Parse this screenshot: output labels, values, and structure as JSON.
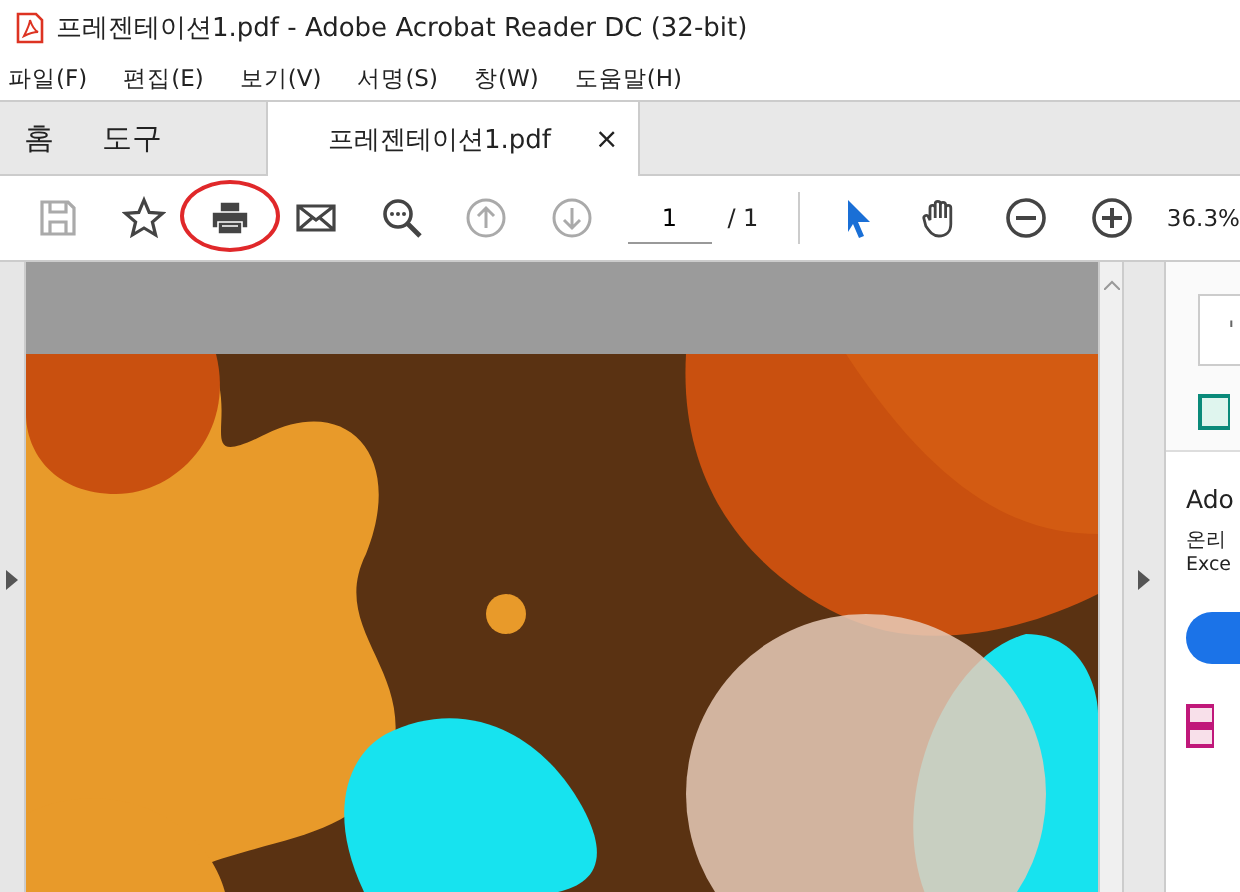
{
  "window": {
    "title": "프레젠테이션1.pdf - Adobe Acrobat Reader DC (32-bit)"
  },
  "menu": [
    "파일(F)",
    "편집(E)",
    "보기(V)",
    "서명(S)",
    "창(W)",
    "도움말(H)"
  ],
  "tabs": [
    {
      "label": "홈",
      "selected": false
    },
    {
      "label": "도구",
      "selected": false
    },
    {
      "label": "프레젠테이션1.pdf",
      "selected": true,
      "close": "×"
    }
  ],
  "toolbar": {
    "buttons": [
      {
        "disabled": true,
        "circled": false
      },
      {
        "disabled": false,
        "circled": false
      },
      {
        "disabled": false,
        "circled": true
      },
      {
        "disabled": false,
        "circled": false
      },
      {
        "disabled": false,
        "circled": false
      },
      {
        "disabled": true,
        "circled": false
      },
      {
        "disabled": true,
        "circled": false
      }
    ],
    "page": "1",
    "page_total": "/ 1",
    "tools": [
      {
        "selected": true
      },
      {
        "selected": false
      },
      {
        "selected": false
      },
      {
        "selected": false
      }
    ],
    "zoom": "36.3%"
  },
  "right_panel": {
    "search": "'",
    "heading": "Ado",
    "line_1": "온리",
    "line_2": "Exce"
  }
}
